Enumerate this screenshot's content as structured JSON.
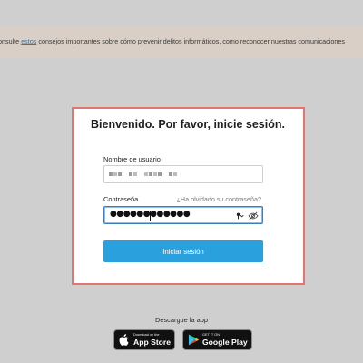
{
  "banner": {
    "prefix": "onsulte ",
    "link": "estos",
    "suffix": " consejos importantes sobre cómo prevenir delitos informáticos, como reconocer nuestras comunicaciones"
  },
  "login": {
    "title": "Bienvenido. Por favor, inicie sesión.",
    "username_label": "Nombre de usuario",
    "password_label": "Contraseña",
    "forgot_link": "¿Ha olvidado su contraseña?",
    "password_value": "●●●●●●●●●●●●",
    "submit_label": "Iniciar sesión"
  },
  "apps": {
    "download_label": "Descargue la app",
    "appstore_small": "Download on the",
    "appstore_big": "App Store",
    "playstore_small": "GET IT ON",
    "playstore_big": "Google Play"
  },
  "colors": {
    "card_border": "#e27570",
    "primary_button": "#2aa1dd",
    "banner_bg": "#d9cfc6",
    "link": "#2a7bb8"
  },
  "icons": {
    "key": "key-icon",
    "eye": "eye-slash-icon",
    "apple": "apple-icon",
    "play": "google-play-icon"
  }
}
